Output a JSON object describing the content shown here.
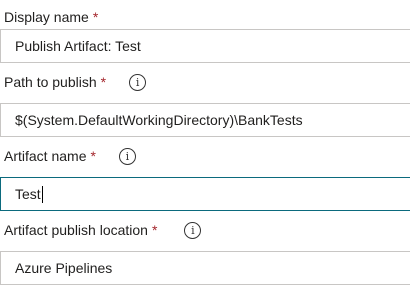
{
  "fields": [
    {
      "label": "Display name",
      "required": "*",
      "value": "Publish Artifact: Test"
    },
    {
      "label": "Path to publish",
      "required": "*",
      "info_icon": "info-icon",
      "value": "$(System.DefaultWorkingDirectory)\\BankTests"
    },
    {
      "label": "Artifact name",
      "required": "*",
      "info_icon": "info-icon",
      "value": "Test"
    },
    {
      "label": "Artifact publish location",
      "required": "*",
      "info_icon": "info-icon",
      "value": "Azure Pipelines"
    }
  ],
  "info_glyph": "i",
  "colors": {
    "required": "#a4262c",
    "focus_border": "#0b6a7d",
    "field_border": "#c8c6c4"
  }
}
